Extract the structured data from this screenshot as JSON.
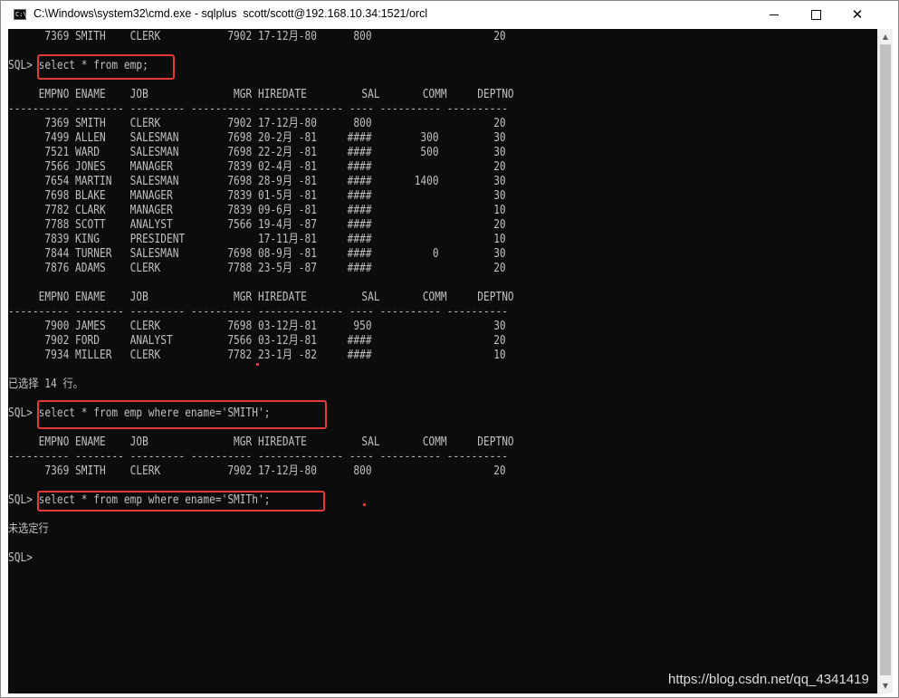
{
  "window": {
    "icon_label": "C:\\",
    "title": "C:\\Windows\\system32\\cmd.exe - sqlplus  scott/scott@192.168.10.34:1521/orcl",
    "controls": {
      "minimize": "",
      "maximize": "",
      "close": "✕"
    }
  },
  "console": {
    "lines": [
      "      7369 SMITH    CLERK           7902 17-12月-80      800                    20",
      "",
      "SQL> select * from emp;",
      "",
      "     EMPNO ENAME    JOB              MGR HIREDATE         SAL       COMM     DEPTNO",
      "---------- -------- --------- ---------- -------------- ---- ---------- ----------",
      "      7369 SMITH    CLERK           7902 17-12月-80      800                    20",
      "      7499 ALLEN    SALESMAN        7698 20-2月 -81     ####        300         30",
      "      7521 WARD     SALESMAN        7698 22-2月 -81     ####        500         30",
      "      7566 JONES    MANAGER         7839 02-4月 -81     ####                    20",
      "      7654 MARTIN   SALESMAN        7698 28-9月 -81     ####       1400         30",
      "      7698 BLAKE    MANAGER         7839 01-5月 -81     ####                    30",
      "      7782 CLARK    MANAGER         7839 09-6月 -81     ####                    10",
      "      7788 SCOTT    ANALYST         7566 19-4月 -87     ####                    20",
      "      7839 KING     PRESIDENT            17-11月-81     ####                    10",
      "      7844 TURNER   SALESMAN        7698 08-9月 -81     ####          0         30",
      "      7876 ADAMS    CLERK           7788 23-5月 -87     ####                    20",
      "",
      "     EMPNO ENAME    JOB              MGR HIREDATE         SAL       COMM     DEPTNO",
      "---------- -------- --------- ---------- -------------- ---- ---------- ----------",
      "      7900 JAMES    CLERK           7698 03-12月-81      950                    30",
      "      7902 FORD     ANALYST         7566 03-12月-81     ####                    20",
      "      7934 MILLER   CLERK           7782 23-1月 -82     ####                    10",
      "",
      "已选择 14 行。",
      "",
      "SQL> select * from emp where ename='SMITH';",
      "",
      "     EMPNO ENAME    JOB              MGR HIREDATE         SAL       COMM     DEPTNO",
      "---------- -------- --------- ---------- -------------- ---- ---------- ----------",
      "      7369 SMITH    CLERK           7902 17-12月-80      800                    20",
      "",
      "SQL> select * from emp where ename='SMITh';",
      "",
      "未选定行",
      "",
      "SQL>"
    ]
  },
  "scrollbar": {
    "up_arrow": "▲",
    "down_arrow": "▼"
  },
  "watermark": "https://blog.csdn.net/qq_4341419",
  "colors": {
    "console_bg": "#0c0c0c",
    "console_text": "#c0c0c0",
    "highlight": "#e43a3a"
  }
}
